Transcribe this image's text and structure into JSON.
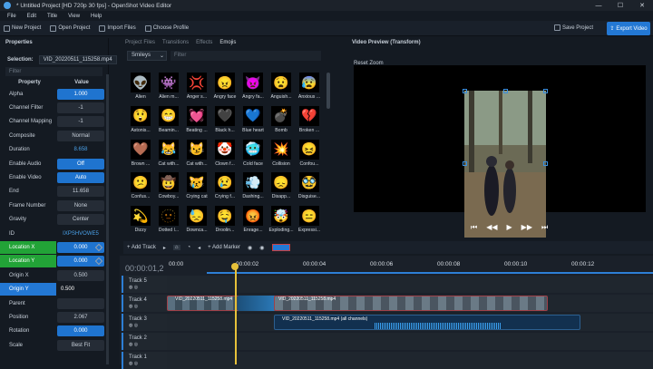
{
  "titlebar": {
    "title": "* Untitled Project [HD 720p 30 fps] - OpenShot Video Editor"
  },
  "menu": [
    "File",
    "Edit",
    "Title",
    "View",
    "Help"
  ],
  "toolbar": {
    "new": "New Project",
    "open": "Open Project",
    "import": "Import Files",
    "profile": "Choose Profile",
    "save": "Save Project",
    "export": "Export Video"
  },
  "props": {
    "header": "Properties",
    "selection_label": "Selection:",
    "selection_value": "VID_20220511_115258.mp4",
    "filter_placeholder": "Filter",
    "col_property": "Property",
    "col_value": "Value",
    "rows": [
      {
        "name": "Alpha",
        "value": "1.000",
        "style": "blue"
      },
      {
        "name": "Channel Filter",
        "value": "-1",
        "style": ""
      },
      {
        "name": "Channel Mapping",
        "value": "-1",
        "style": ""
      },
      {
        "name": "Composite",
        "value": "Normal",
        "style": ""
      },
      {
        "name": "Duration",
        "value": "8.658",
        "style": "plain"
      },
      {
        "name": "Enable Audio",
        "value": "Off",
        "style": "blue"
      },
      {
        "name": "Enable Video",
        "value": "Auto",
        "style": "blue"
      },
      {
        "name": "End",
        "value": "11.658",
        "style": ""
      },
      {
        "name": "Frame Number",
        "value": "None",
        "style": ""
      },
      {
        "name": "Gravity",
        "value": "Center",
        "style": ""
      },
      {
        "name": "ID",
        "value": "IXPSHVOWE5",
        "style": "plain"
      },
      {
        "name": "Location X",
        "value": "0.000",
        "style": "blue",
        "row": "green"
      },
      {
        "name": "Location Y",
        "value": "0.000",
        "style": "blue",
        "row": "green"
      },
      {
        "name": "Origin X",
        "value": "0.500",
        "style": ""
      },
      {
        "name": "Origin Y",
        "value": "0.500",
        "style": "plain",
        "row": "bluerow"
      },
      {
        "name": "Parent",
        "value": "",
        "style": ""
      },
      {
        "name": "Position",
        "value": "2.067",
        "style": ""
      },
      {
        "name": "Rotation",
        "value": "0.000",
        "style": "blue"
      },
      {
        "name": "Scale",
        "value": "Best Fit",
        "style": ""
      }
    ]
  },
  "files": {
    "tabs": [
      "Project Files",
      "Transitions",
      "Effects",
      "Emojis"
    ],
    "category": "Smileys",
    "filter_placeholder": "Filter",
    "emojis": [
      {
        "label": "Alien",
        "glyph": "👽"
      },
      {
        "label": "Alien m...",
        "glyph": "👾"
      },
      {
        "label": "Anger s...",
        "glyph": "💢"
      },
      {
        "label": "Angry face",
        "glyph": "😠"
      },
      {
        "label": "Angry fa...",
        "glyph": "👿"
      },
      {
        "label": "Anguish...",
        "glyph": "😧"
      },
      {
        "label": "Anxious ...",
        "glyph": "😰"
      },
      {
        "label": "Astonis...",
        "glyph": "😲"
      },
      {
        "label": "Beamin...",
        "glyph": "😁"
      },
      {
        "label": "Beating ...",
        "glyph": "💓"
      },
      {
        "label": "Black h...",
        "glyph": "🖤"
      },
      {
        "label": "Blue heart",
        "glyph": "💙"
      },
      {
        "label": "Bomb",
        "glyph": "💣"
      },
      {
        "label": "Broken ...",
        "glyph": "💔"
      },
      {
        "label": "Brown ...",
        "glyph": "🤎"
      },
      {
        "label": "Cat with...",
        "glyph": "😹"
      },
      {
        "label": "Cat with...",
        "glyph": "😼"
      },
      {
        "label": "Clown f...",
        "glyph": "🤡"
      },
      {
        "label": "Cold face",
        "glyph": "🥶"
      },
      {
        "label": "Collision",
        "glyph": "💥"
      },
      {
        "label": "Confou...",
        "glyph": "😖"
      },
      {
        "label": "Confus...",
        "glyph": "😕"
      },
      {
        "label": "Cowboy...",
        "glyph": "🤠"
      },
      {
        "label": "Crying cat",
        "glyph": "😿"
      },
      {
        "label": "Crying f...",
        "glyph": "😢"
      },
      {
        "label": "Dashing...",
        "glyph": "💨"
      },
      {
        "label": "Disapp...",
        "glyph": "😞"
      },
      {
        "label": "Disguise...",
        "glyph": "🥸"
      },
      {
        "label": "Dizzy",
        "glyph": "💫"
      },
      {
        "label": "Dotted l...",
        "glyph": "🫥"
      },
      {
        "label": "Downca...",
        "glyph": "😓"
      },
      {
        "label": "Droolin...",
        "glyph": "🤤"
      },
      {
        "label": "Enrage...",
        "glyph": "😡"
      },
      {
        "label": "Exploding...",
        "glyph": "🤯"
      },
      {
        "label": "Expressi...",
        "glyph": "😑"
      }
    ]
  },
  "preview": {
    "header": "Video Preview (Transform)",
    "reset": "Reset Zoom",
    "controls": [
      "⏮",
      "◀◀",
      "▶",
      "▶▶",
      "⏭"
    ]
  },
  "timeline_tools": {
    "add_track": "Add Track",
    "add_marker": "Add Marker"
  },
  "timeline": {
    "timecode": "00:00:01,2",
    "ticks": [
      "00:00",
      "00:00:02",
      "00:00:04",
      "00:00:06",
      "00:00:08",
      "00:00:10",
      "00:00:12"
    ],
    "tracks": [
      "Track 5",
      "Track 4",
      "Track 3",
      "Track 2",
      "Track 1"
    ],
    "clip_video": "VID_20220511_115258.mp4",
    "clip_audio": "VID_20220511_115258.mp4 (all channels)"
  },
  "colors": {
    "accent": "#2378d4",
    "green": "#22a337",
    "playhead": "#e6c13a"
  }
}
